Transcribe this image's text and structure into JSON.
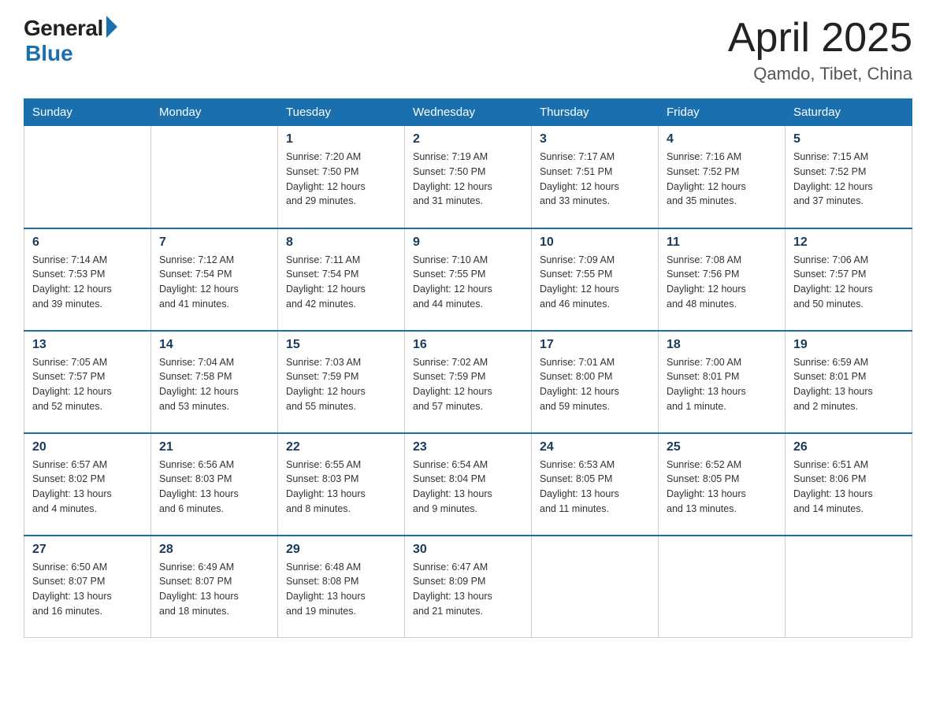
{
  "logo": {
    "general": "General",
    "blue": "Blue",
    "subtitle": "Blue"
  },
  "title": "April 2025",
  "location": "Qamdo, Tibet, China",
  "weekdays": [
    "Sunday",
    "Monday",
    "Tuesday",
    "Wednesday",
    "Thursday",
    "Friday",
    "Saturday"
  ],
  "weeks": [
    [
      {
        "day": "",
        "info": ""
      },
      {
        "day": "",
        "info": ""
      },
      {
        "day": "1",
        "info": "Sunrise: 7:20 AM\nSunset: 7:50 PM\nDaylight: 12 hours\nand 29 minutes."
      },
      {
        "day": "2",
        "info": "Sunrise: 7:19 AM\nSunset: 7:50 PM\nDaylight: 12 hours\nand 31 minutes."
      },
      {
        "day": "3",
        "info": "Sunrise: 7:17 AM\nSunset: 7:51 PM\nDaylight: 12 hours\nand 33 minutes."
      },
      {
        "day": "4",
        "info": "Sunrise: 7:16 AM\nSunset: 7:52 PM\nDaylight: 12 hours\nand 35 minutes."
      },
      {
        "day": "5",
        "info": "Sunrise: 7:15 AM\nSunset: 7:52 PM\nDaylight: 12 hours\nand 37 minutes."
      }
    ],
    [
      {
        "day": "6",
        "info": "Sunrise: 7:14 AM\nSunset: 7:53 PM\nDaylight: 12 hours\nand 39 minutes."
      },
      {
        "day": "7",
        "info": "Sunrise: 7:12 AM\nSunset: 7:54 PM\nDaylight: 12 hours\nand 41 minutes."
      },
      {
        "day": "8",
        "info": "Sunrise: 7:11 AM\nSunset: 7:54 PM\nDaylight: 12 hours\nand 42 minutes."
      },
      {
        "day": "9",
        "info": "Sunrise: 7:10 AM\nSunset: 7:55 PM\nDaylight: 12 hours\nand 44 minutes."
      },
      {
        "day": "10",
        "info": "Sunrise: 7:09 AM\nSunset: 7:55 PM\nDaylight: 12 hours\nand 46 minutes."
      },
      {
        "day": "11",
        "info": "Sunrise: 7:08 AM\nSunset: 7:56 PM\nDaylight: 12 hours\nand 48 minutes."
      },
      {
        "day": "12",
        "info": "Sunrise: 7:06 AM\nSunset: 7:57 PM\nDaylight: 12 hours\nand 50 minutes."
      }
    ],
    [
      {
        "day": "13",
        "info": "Sunrise: 7:05 AM\nSunset: 7:57 PM\nDaylight: 12 hours\nand 52 minutes."
      },
      {
        "day": "14",
        "info": "Sunrise: 7:04 AM\nSunset: 7:58 PM\nDaylight: 12 hours\nand 53 minutes."
      },
      {
        "day": "15",
        "info": "Sunrise: 7:03 AM\nSunset: 7:59 PM\nDaylight: 12 hours\nand 55 minutes."
      },
      {
        "day": "16",
        "info": "Sunrise: 7:02 AM\nSunset: 7:59 PM\nDaylight: 12 hours\nand 57 minutes."
      },
      {
        "day": "17",
        "info": "Sunrise: 7:01 AM\nSunset: 8:00 PM\nDaylight: 12 hours\nand 59 minutes."
      },
      {
        "day": "18",
        "info": "Sunrise: 7:00 AM\nSunset: 8:01 PM\nDaylight: 13 hours\nand 1 minute."
      },
      {
        "day": "19",
        "info": "Sunrise: 6:59 AM\nSunset: 8:01 PM\nDaylight: 13 hours\nand 2 minutes."
      }
    ],
    [
      {
        "day": "20",
        "info": "Sunrise: 6:57 AM\nSunset: 8:02 PM\nDaylight: 13 hours\nand 4 minutes."
      },
      {
        "day": "21",
        "info": "Sunrise: 6:56 AM\nSunset: 8:03 PM\nDaylight: 13 hours\nand 6 minutes."
      },
      {
        "day": "22",
        "info": "Sunrise: 6:55 AM\nSunset: 8:03 PM\nDaylight: 13 hours\nand 8 minutes."
      },
      {
        "day": "23",
        "info": "Sunrise: 6:54 AM\nSunset: 8:04 PM\nDaylight: 13 hours\nand 9 minutes."
      },
      {
        "day": "24",
        "info": "Sunrise: 6:53 AM\nSunset: 8:05 PM\nDaylight: 13 hours\nand 11 minutes."
      },
      {
        "day": "25",
        "info": "Sunrise: 6:52 AM\nSunset: 8:05 PM\nDaylight: 13 hours\nand 13 minutes."
      },
      {
        "day": "26",
        "info": "Sunrise: 6:51 AM\nSunset: 8:06 PM\nDaylight: 13 hours\nand 14 minutes."
      }
    ],
    [
      {
        "day": "27",
        "info": "Sunrise: 6:50 AM\nSunset: 8:07 PM\nDaylight: 13 hours\nand 16 minutes."
      },
      {
        "day": "28",
        "info": "Sunrise: 6:49 AM\nSunset: 8:07 PM\nDaylight: 13 hours\nand 18 minutes."
      },
      {
        "day": "29",
        "info": "Sunrise: 6:48 AM\nSunset: 8:08 PM\nDaylight: 13 hours\nand 19 minutes."
      },
      {
        "day": "30",
        "info": "Sunrise: 6:47 AM\nSunset: 8:09 PM\nDaylight: 13 hours\nand 21 minutes."
      },
      {
        "day": "",
        "info": ""
      },
      {
        "day": "",
        "info": ""
      },
      {
        "day": "",
        "info": ""
      }
    ]
  ]
}
